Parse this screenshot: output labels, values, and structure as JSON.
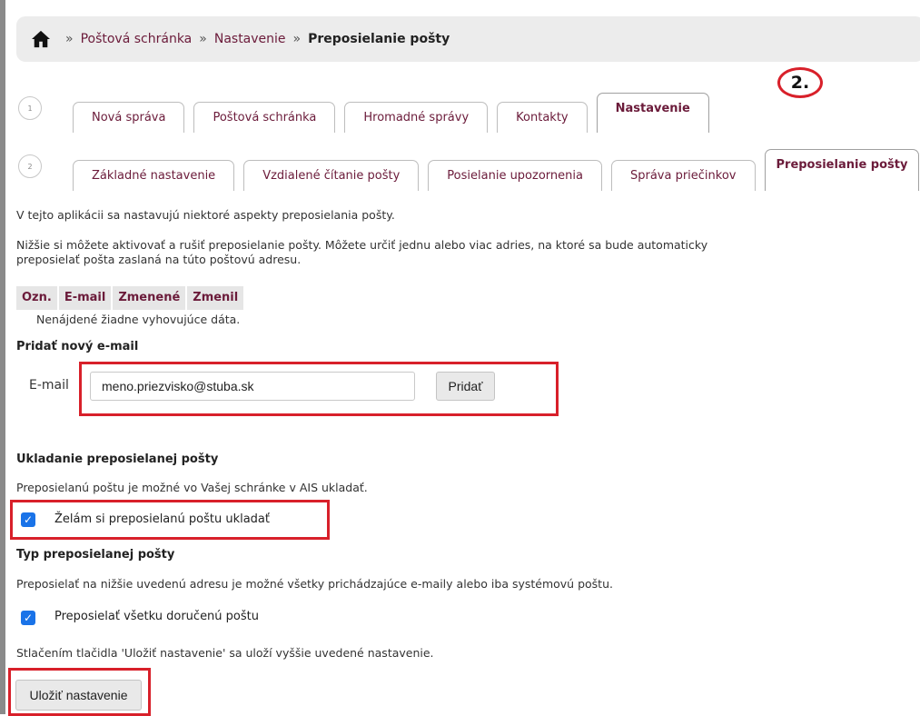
{
  "breadcrumb": {
    "items": [
      "Poštová schránka",
      "Nastavenie",
      "Preposielanie pošty"
    ]
  },
  "annotation": "2.",
  "tabs_row1": {
    "step": "1",
    "items": [
      "Nová správa",
      "Poštová schránka",
      "Hromadné správy",
      "Kontakty",
      "Nastavenie"
    ],
    "active": "Nastavenie"
  },
  "tabs_row2": {
    "step": "2",
    "items": [
      "Základné nastavenie",
      "Vzdialené čítanie pošty",
      "Posielanie upozornenia",
      "Správa priečinkov",
      "Preposielanie pošty"
    ],
    "active": "Preposielanie pošty"
  },
  "intro": "V tejto aplikácii sa nastavujú niektoré aspekty preposielania pošty.",
  "description_line1": "Nižšie si môžete aktivovať a rušiť preposielanie pošty. Môžete určiť jednu alebo viac adries, na ktoré sa bude automaticky",
  "description_line2": "preposielať pošta zaslaná na túto poštovú adresu.",
  "table": {
    "columns": [
      "Ozn.",
      "E-mail",
      "Zmenené",
      "Zmenil"
    ],
    "empty_text": "Nenájdené žiadne vyhovujúce dáta."
  },
  "add_email": {
    "heading": "Pridať nový e-mail",
    "label": "E-mail",
    "value": "meno.priezvisko@stuba.sk",
    "button": "Pridať"
  },
  "save_section": {
    "heading": "Ukladanie preposielanej pošty",
    "text": "Preposielanú poštu je možné vo Vašej schránke v AIS ukladať.",
    "checkbox_label": "Želám si preposielanú poštu ukladať",
    "checked": true
  },
  "type_section": {
    "heading": "Typ preposielanej pošty",
    "text": "Preposielať na nižšie uvedenú adresu je možné všetky prichádzajúce e-maily alebo iba systémovú poštu.",
    "checkbox_label": "Preposielať všetku doručenú poštu",
    "checked": true
  },
  "footer": {
    "text": "Stlačením tlačidla 'Uložiť nastavenie' sa uloží vyššie uvedené nastavenie.",
    "save_button": "Uložiť nastavenie"
  },
  "colors": {
    "accent": "#6b1b3a",
    "highlight": "#d8202a",
    "checkbox": "#1a73e8"
  }
}
